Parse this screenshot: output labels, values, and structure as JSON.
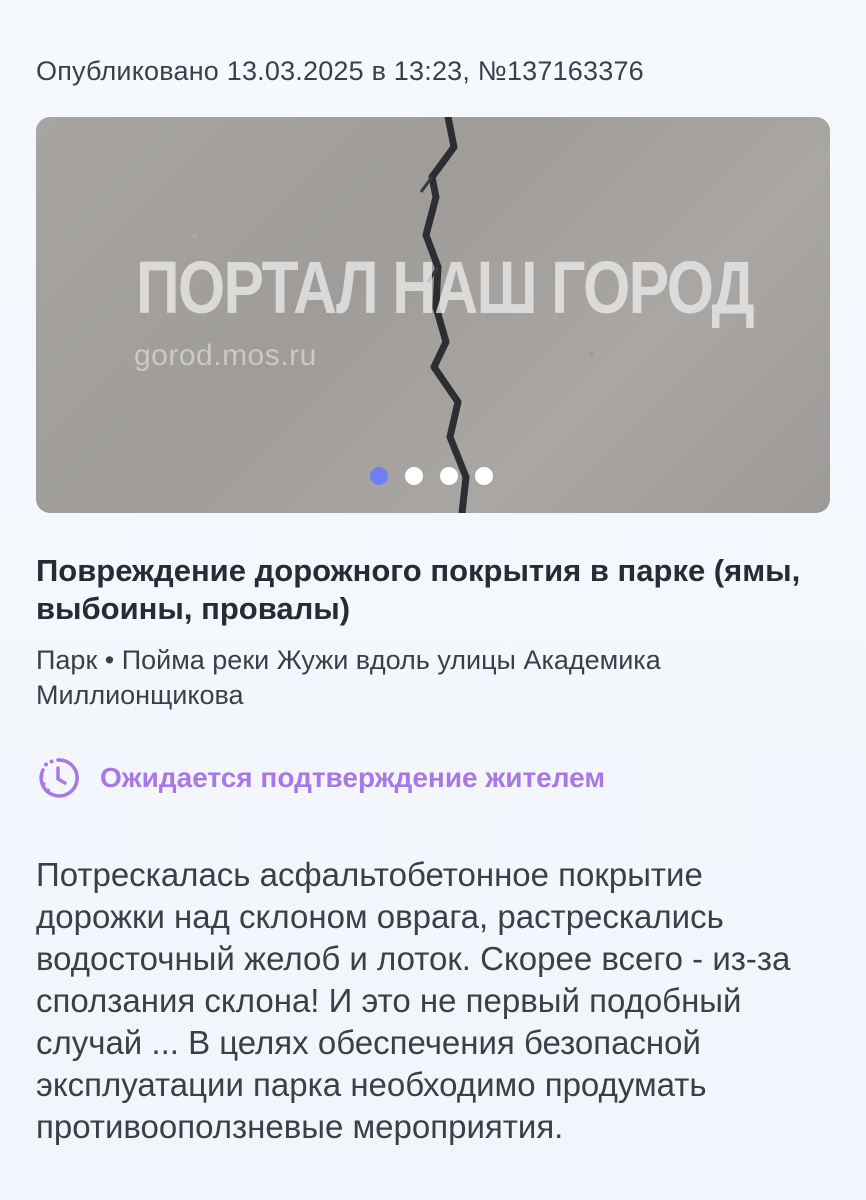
{
  "published": "Опубликовано 13.03.2025 в 13:23, №137163376",
  "photo": {
    "watermark_title": "ПОРТАЛ НАШ ГОРОД",
    "watermark_url": "gorod.mos.ru",
    "carousel_total": 4,
    "carousel_active": 1
  },
  "issue": {
    "title": "Повреждение дорожного покрытия в парке (ямы, выбоины, провалы)",
    "location": "Парк • Пойма реки Жужи вдоль улицы Академика Миллионщикова"
  },
  "status": {
    "icon": "clock-dashed-icon",
    "text": "Ожидается подтверждение жителем",
    "color": "#a978e6"
  },
  "description": "Потрескалась асфальтобетонное покрытие дорожки над склоном оврага, растрескались водосточный желоб и лоток. Скорее всего - из-за сползания склона! И это не первый подобный случай ... В целях обеспечения безопасной эксплуатации парка необходимо продумать противооползневые мероприятия."
}
